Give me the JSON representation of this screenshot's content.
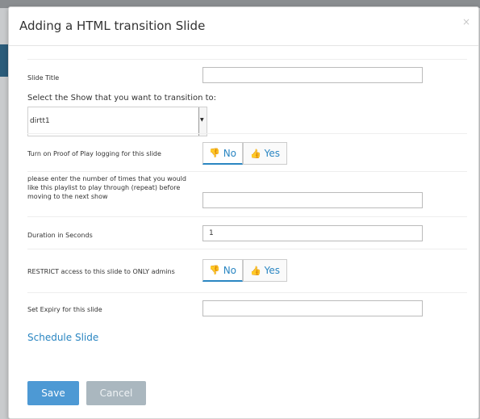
{
  "modal": {
    "title": "Adding a HTML transition Slide",
    "close_label": "×"
  },
  "form": {
    "slide_title": {
      "label": "Slide Title",
      "value": ""
    },
    "show_select": {
      "label": "Select the Show that you want to transition to:",
      "selected": "dirtt1"
    },
    "proof_of_play": {
      "label": "Turn on Proof of Play logging for this slide",
      "no_label": "No",
      "yes_label": "Yes",
      "selected": "No"
    },
    "repeat": {
      "label_lines": [
        "please enter the number of times that you would",
        "like this playlist to play through (repeat) before",
        "moving to the next show"
      ],
      "value": ""
    },
    "duration": {
      "label": "Duration in Seconds",
      "value": "1"
    },
    "restrict": {
      "label": "RESTRICT access to this slide to ONLY admins",
      "no_label": "No",
      "yes_label": "Yes",
      "selected": "No"
    },
    "expiry": {
      "label": "Set Expiry for this slide",
      "value": ""
    },
    "schedule_link": "Schedule Slide"
  },
  "footer": {
    "save_label": "Save",
    "cancel_label": "Cancel"
  },
  "icons": {
    "no": "thumbs-down-icon",
    "yes": "thumbs-up-icon"
  },
  "colors": {
    "accent": "#2a86c2",
    "save_button": "#4d99d4",
    "cancel_button": "#aab7bf"
  }
}
